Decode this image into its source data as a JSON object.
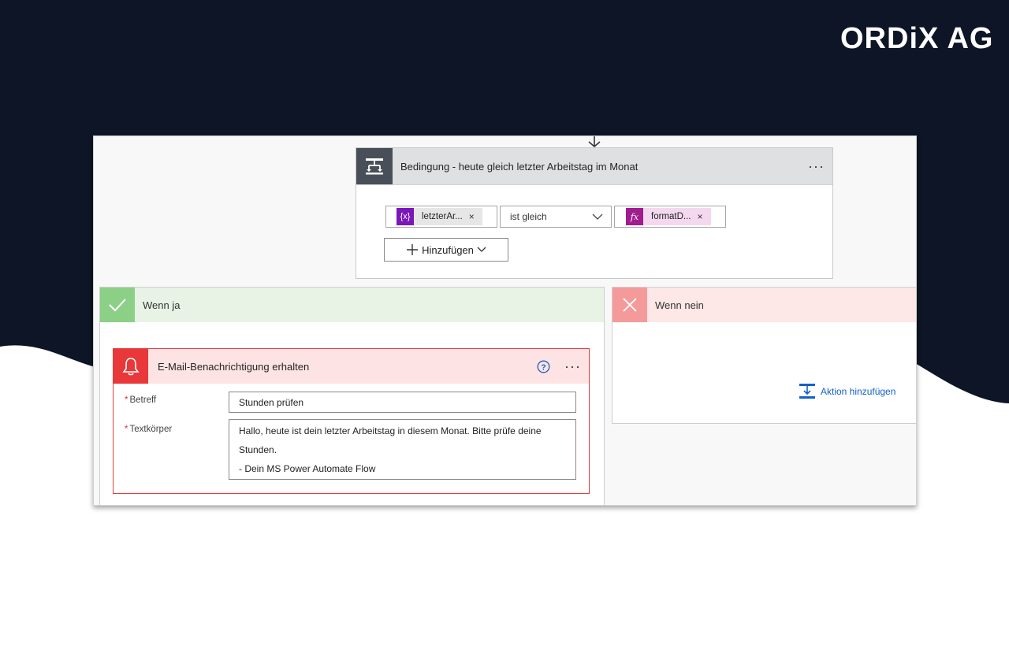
{
  "brand": {
    "logo_text": "ORDiX AG"
  },
  "condition": {
    "title": "Bedingung - heute gleich letzter Arbeitstag im Monat",
    "more_label": "···",
    "left_token": {
      "icon": "{x}",
      "label": "letzterAr...",
      "remove": "×",
      "color": "#7a17b8"
    },
    "operator": "ist gleich",
    "right_token": {
      "icon": "fx",
      "label": "formatD...",
      "remove": "×",
      "color": "#a01c8f"
    },
    "add_button": "Hinzufügen"
  },
  "branch_yes": {
    "label": "Wenn ja",
    "action": {
      "title": "E-Mail-Benachrichtigung erhalten",
      "more_label": "···",
      "fields": {
        "subject_label": "Betreff",
        "subject_value": "Stunden prüfen",
        "body_label": "Textkörper",
        "body_lines": [
          "Hallo, heute ist dein letzter Arbeitstag in diesem Monat. Bitte prüfe deine",
          "Stunden.",
          "- Dein MS Power Automate Flow"
        ],
        "required_marker": "*"
      }
    }
  },
  "branch_no": {
    "label": "Wenn nein",
    "add_action": "Aktion hinzufügen"
  },
  "colors": {
    "background_dark": "#0d1526",
    "yes_accent": "#8ccf86",
    "no_accent": "#f49a9a",
    "mail_accent": "#e8383a",
    "link": "#1460c7"
  },
  "icons": [
    "condition-icon",
    "variable-icon",
    "function-icon",
    "chevron-down-icon",
    "plus-icon",
    "check-icon",
    "close-x-icon",
    "bell-icon",
    "help-icon",
    "add-action-icon",
    "down-arrow-icon"
  ]
}
